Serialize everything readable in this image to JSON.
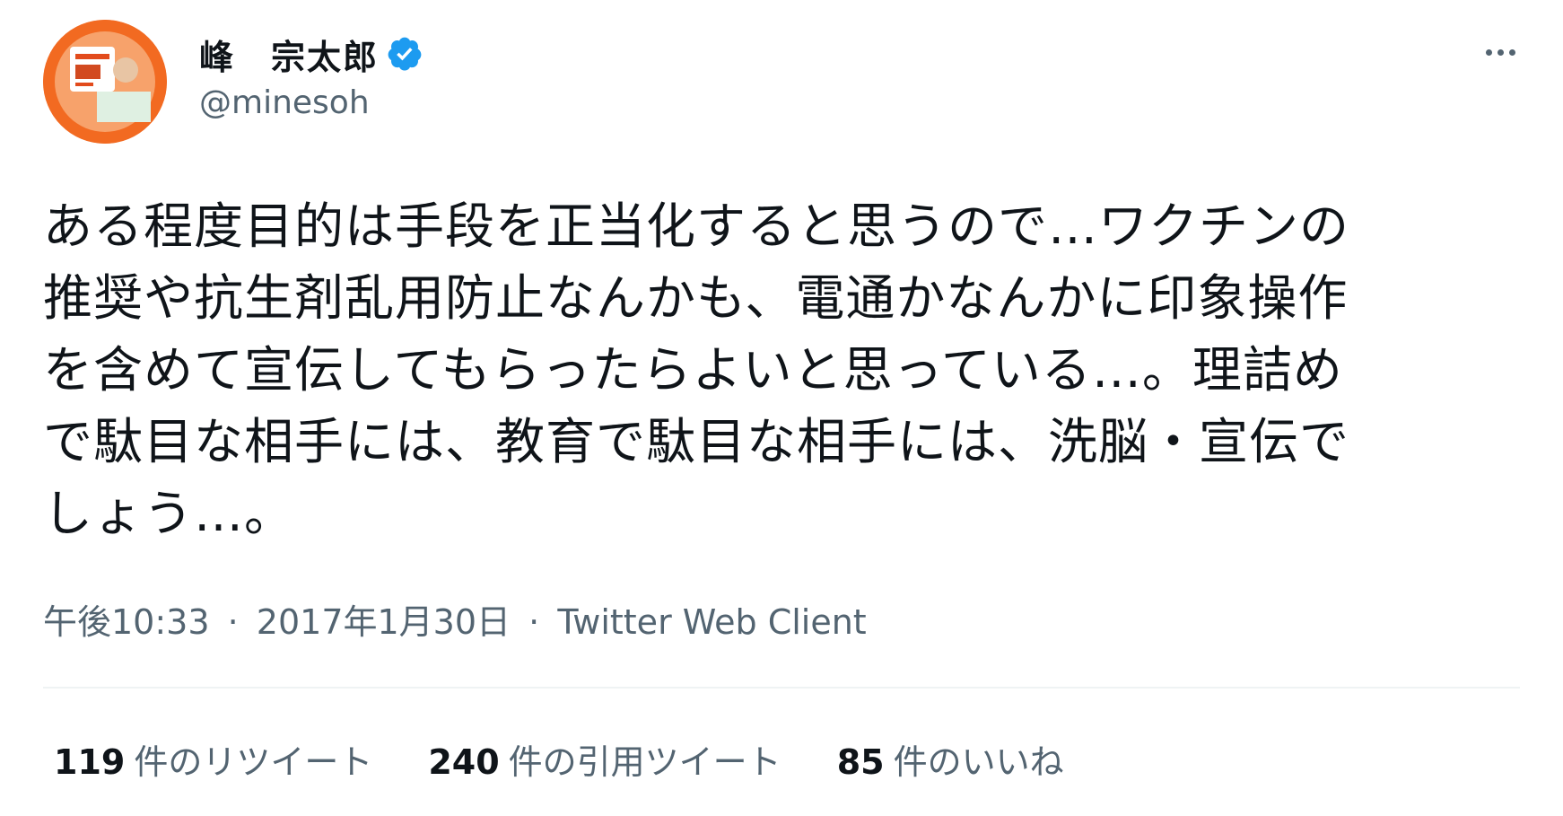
{
  "author": {
    "display_name": "峰　宗太郎",
    "handle": "@minesoh",
    "verified": true,
    "avatar_icon": "profile-photo"
  },
  "menu": {
    "more_icon": "ellipsis-icon"
  },
  "tweet": {
    "lines": [
      "ある程度目的は手段を正当化すると思うので…ワクチンの",
      "推奨や抗生剤乱用防止なんかも、電通かなんかに印象操作",
      "を含めて宣伝してもらったらよいと思っている…。理詰め",
      "で駄目な相手には、教育で駄目な相手には、洗脳・宣伝で",
      "しょう…。"
    ]
  },
  "meta": {
    "time": "午後10:33",
    "separator": "·",
    "date": "2017年1月30日",
    "source": "Twitter Web Client"
  },
  "stats": {
    "retweets": {
      "count": "119",
      "label": "件のリツイート"
    },
    "quotes": {
      "count": "240",
      "label": "件の引用ツイート"
    },
    "likes": {
      "count": "85",
      "label": "件のいいね"
    }
  },
  "colors": {
    "text": "#0f1419",
    "secondary": "#536471",
    "verified_blue": "#1d9bf0",
    "divider": "#eff3f4",
    "avatar_orange": "#f26a21"
  }
}
